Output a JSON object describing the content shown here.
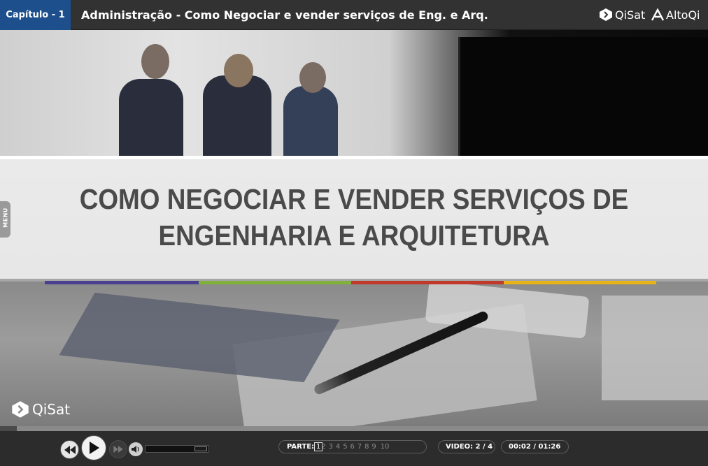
{
  "header": {
    "chapter": "Capítulo - 1",
    "course_title": "Administração - Como Negociar e vender serviços de Eng. e Arq.",
    "brand_qisat": "QiSat",
    "brand_altoqi": "AltoQi"
  },
  "slide": {
    "title_line1": "COMO NEGOCIAR E VENDER SERVIÇOS DE",
    "title_line2": "ENGENHARIA E ARQUITETURA",
    "bar_colors": [
      "#4b3f8f",
      "#7fb13b",
      "#c0392b",
      "#e8b21a"
    ],
    "watermark": "QiSat"
  },
  "menu": {
    "label": "MENU"
  },
  "progress": {
    "value_fraction": 0.024
  },
  "player": {
    "parts_label": "PARTE:",
    "parts": [
      "1",
      "2",
      "3",
      "4",
      "5",
      "6",
      "7",
      "8",
      "9",
      "10"
    ],
    "active_part": "1",
    "video_label": "VIDEO:",
    "video_value": "2 / 4",
    "time": "00:02 / 01:26",
    "volume_fraction": 0.85
  },
  "colors": {
    "chapter_bg": "#1d4f8c",
    "header_bg": "#323232",
    "controls_bg": "#2c2c2c"
  }
}
